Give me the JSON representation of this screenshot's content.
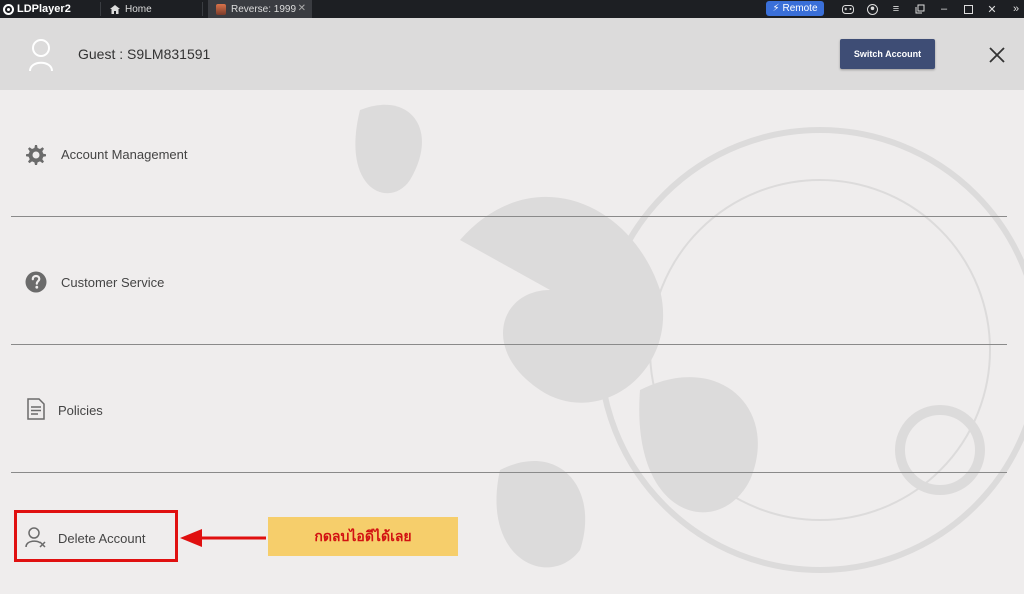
{
  "titlebar": {
    "app_name": "LDPlayer2",
    "home_tab": "Home",
    "game_tab": "Reverse: 1999",
    "remote_label": "Remote"
  },
  "header": {
    "guest_label": "Guest : S9LM831591",
    "switch_label": "Switch Account"
  },
  "menu": {
    "items": [
      {
        "label": "Account Management",
        "icon": "gear-icon"
      },
      {
        "label": "Customer Service",
        "icon": "question-icon"
      },
      {
        "label": "Policies",
        "icon": "document-icon"
      },
      {
        "label": "Delete Account",
        "icon": "user-remove-icon"
      }
    ]
  },
  "annotation": {
    "note_text": "กดลบไอดีได้เลย",
    "highlight_color": "#e01010",
    "note_bg": "#f6ce6b"
  }
}
